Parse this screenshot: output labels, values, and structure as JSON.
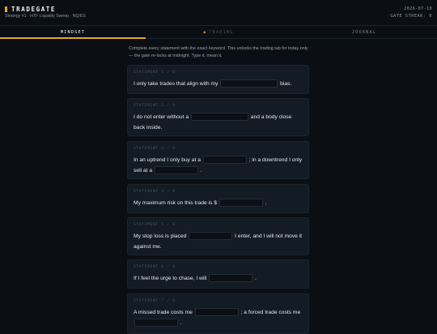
{
  "header": {
    "app_title": "TRADEGATE",
    "subtitle": "Strategy #1 · HTF Liquidity Sweep · NQ/ES",
    "date": "2026-07-10",
    "streak": "GATE STREAK: 0"
  },
  "tabs": [
    {
      "label": "MINDSET",
      "state": "active"
    },
    {
      "label": "TRADING",
      "state": "locked",
      "icon": "lock-icon"
    },
    {
      "label": "JOURNAL",
      "state": "inactive"
    }
  ],
  "intro": "Complete every statement with the exact keyword. This unlocks the trading tab for today only — the gate re-locks at midnight. Type it, mean it.",
  "statements": [
    {
      "label": "STATEMENT 1 / 8",
      "parts": [
        "I only take trades that align with my",
        "bias."
      ]
    },
    {
      "label": "STATEMENT 2 / 8",
      "parts": [
        "I do not enter without a",
        "and a body close back inside."
      ]
    },
    {
      "label": "STATEMENT 3 / 8",
      "parts": [
        "In an uptrend I only buy at a",
        "; in a downtrend I only sell at a",
        "."
      ]
    },
    {
      "label": "STATEMENT 4 / 8",
      "parts": [
        "My maximum risk on this trade is $",
        "."
      ]
    },
    {
      "label": "STATEMENT 5 / 8",
      "parts": [
        "My stop loss is placed",
        "I enter, and I will not move it against me."
      ]
    },
    {
      "label": "STATEMENT 6 / 8",
      "parts": [
        "If I feel the urge to chase, I will",
        "."
      ]
    },
    {
      "label": "STATEMENT 7 / 8",
      "parts": [
        "A missed trade costs me",
        "; a forced trade costs me",
        "."
      ]
    }
  ],
  "colors": {
    "accent": "#e0a829",
    "background": "#0b0f14",
    "card": "#131b24"
  }
}
